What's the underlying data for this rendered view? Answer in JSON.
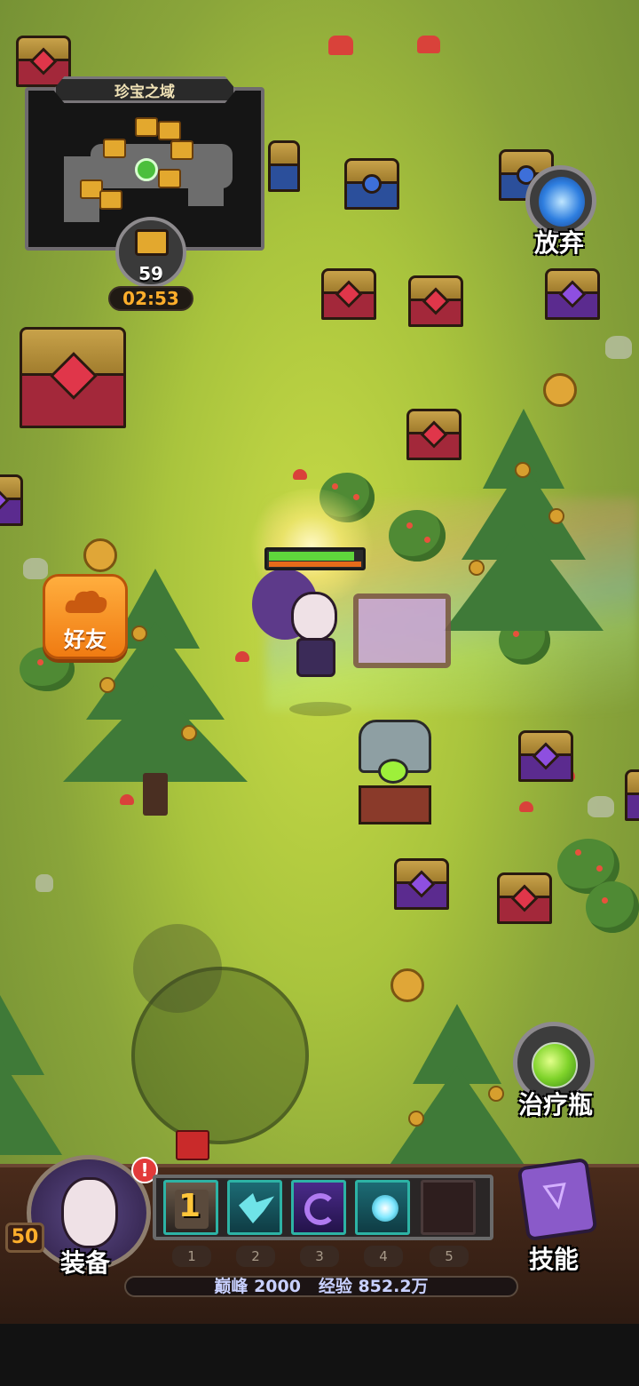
{
  "map": {
    "title": "珍宝之域",
    "chests_remaining": "59",
    "timer": "02:53"
  },
  "buttons": {
    "abandon": "放弃",
    "friends": "好友",
    "potion": "治疗瓶",
    "equipment": "装备",
    "skills": "技能"
  },
  "player": {
    "level": "50",
    "alert": "!",
    "hp_fraction": 0.92
  },
  "skill_slots": [
    {
      "number": "1",
      "icon": "tower-skill-icon",
      "badge": "1"
    },
    {
      "number": "2",
      "icon": "eagle-skill-icon"
    },
    {
      "number": "3",
      "icon": "shadow-swirl-skill-icon"
    },
    {
      "number": "4",
      "icon": "orb-skill-icon"
    },
    {
      "number": "5",
      "icon": "empty-slot"
    }
  ],
  "status": {
    "peak_label": "巅峰",
    "peak_value": "2000",
    "exp_label": "经验",
    "exp_value": "852.2万"
  },
  "colors": {
    "grass": "#a9c43d",
    "accent_orange": "#ffae2b",
    "chest_red": "#a3283a",
    "chest_blue": "#2b4f9b",
    "chest_purple": "#5b2b8f",
    "skill_border": "#2db3a5"
  }
}
